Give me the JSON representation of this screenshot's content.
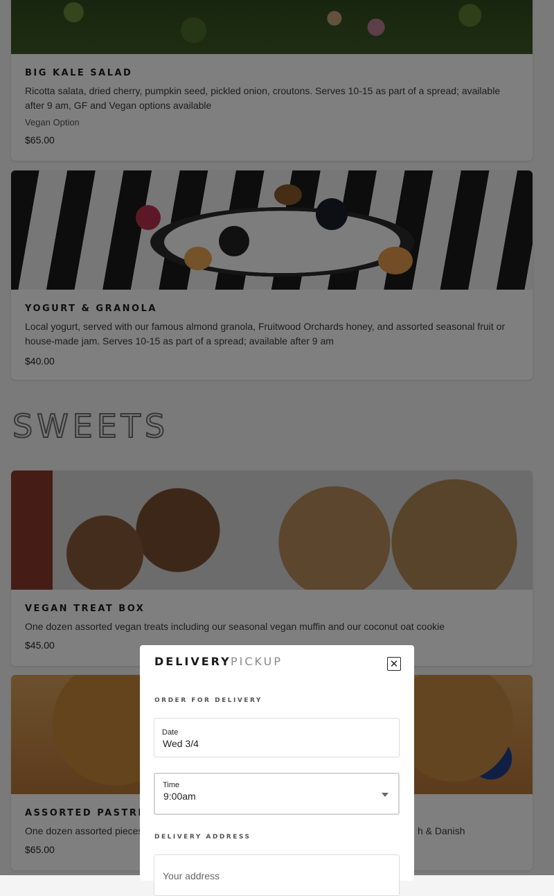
{
  "menu": {
    "items_top": [
      {
        "title": "BIG KALE SALAD",
        "description": "Ricotta salata, dried cherry, pumpkin seed, pickled onion, croutons. Serves 10-15 as part of a spread; available after 9 am, GF and Vegan options available",
        "tag": "Vegan Option",
        "price": "$65.00"
      },
      {
        "title": "YOGURT & GRANOLA",
        "description": "Local yogurt, served with our famous almond granola, Fruitwood Orchards honey, and assorted seasonal fruit or house-made jam. Serves 10-15 as part of a spread; available after 9 am",
        "price": "$40.00"
      }
    ],
    "section_title": "SWEETS",
    "items_sweets": [
      {
        "title": "VEGAN TREAT BOX",
        "description": "One dozen assorted vegan treats including our seasonal vegan muffin and our coconut oat cookie",
        "price": "$45.00"
      },
      {
        "title": "ASSORTED PASTRIES",
        "description_left": "One dozen assorted pieces",
        "description_right": "h & Danish",
        "price": "$65.00"
      }
    ]
  },
  "modal": {
    "tabs": {
      "delivery": "DELIVERY",
      "pickup": "PICKUP"
    },
    "close_icon": "close-icon",
    "order_heading": "ORDER FOR DELIVERY",
    "date": {
      "label": "Date",
      "value": "Wed 3/4"
    },
    "time": {
      "label": "Time",
      "value": "9:00am"
    },
    "address_heading": "DELIVERY ADDRESS",
    "address": {
      "placeholder": "Your address"
    }
  }
}
